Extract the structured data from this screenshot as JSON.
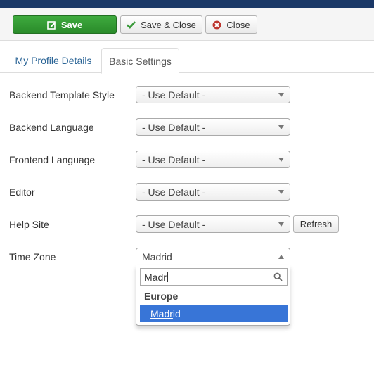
{
  "toolbar": {
    "save_label": "Save",
    "save_close_label": "Save & Close",
    "close_label": "Close"
  },
  "tabs": [
    {
      "label": "My Profile Details",
      "active": false
    },
    {
      "label": "Basic Settings",
      "active": true
    }
  ],
  "fields": [
    {
      "label": "Backend Template Style",
      "value": "- Use Default -"
    },
    {
      "label": "Backend Language",
      "value": "- Use Default -"
    },
    {
      "label": "Frontend Language",
      "value": "- Use Default -"
    },
    {
      "label": "Editor",
      "value": "- Use Default -"
    },
    {
      "label": "Help Site",
      "value": "- Use Default -",
      "button": "Refresh"
    }
  ],
  "timezone": {
    "label": "Time Zone",
    "value": "Madrid",
    "search_value": "Madr",
    "group": "Europe",
    "option": {
      "match": "Madr",
      "rest": "id"
    }
  },
  "colors": {
    "header": "#1a3867",
    "save_green": "#2f9a2f",
    "link_blue": "#2a6496",
    "highlight": "#3875d7"
  },
  "icons": {
    "save": "edit-square-icon",
    "save_close": "check-icon",
    "close": "close-circle-icon",
    "search": "search-icon"
  }
}
